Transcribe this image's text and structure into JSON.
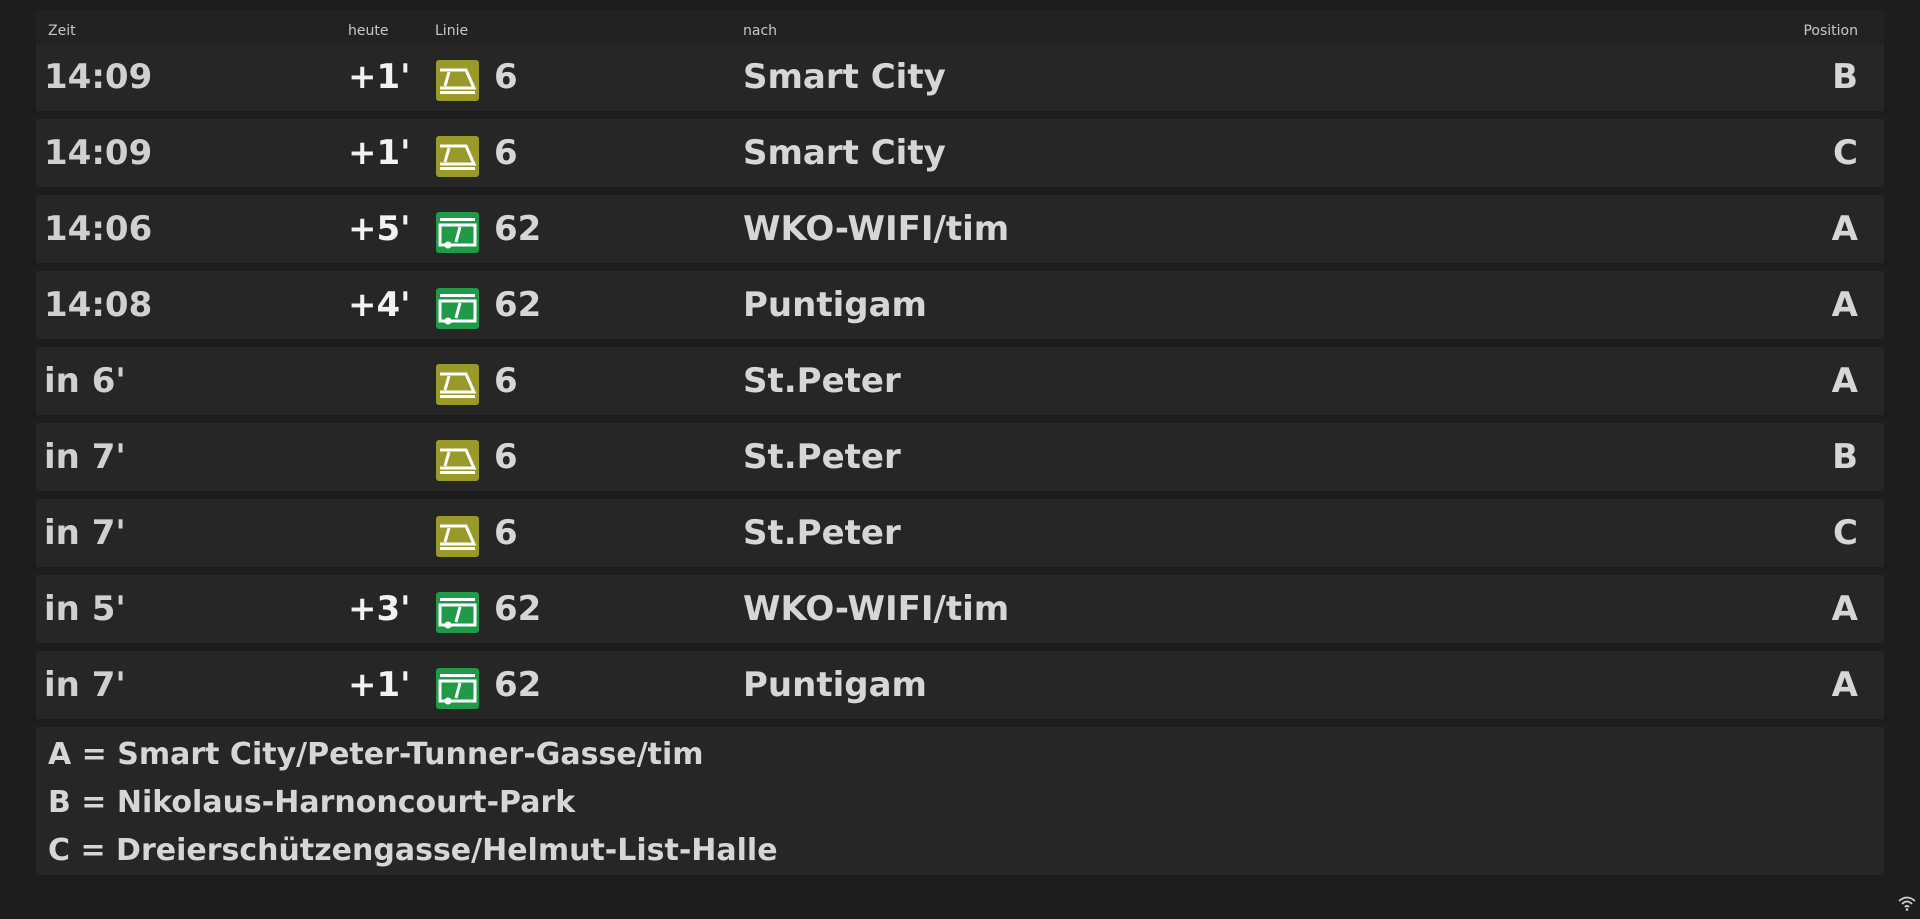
{
  "header": {
    "zeit": "Zeit",
    "heute": "heute",
    "linie": "Linie",
    "nach": "nach",
    "position": "Position"
  },
  "departures": [
    {
      "time": "14:09",
      "delay": "+1'",
      "icon": "tram-icon",
      "line": "6",
      "destination": "Smart City",
      "position": "B"
    },
    {
      "time": "14:09",
      "delay": "+1'",
      "icon": "tram-icon",
      "line": "6",
      "destination": "Smart City",
      "position": "C"
    },
    {
      "time": "14:06",
      "delay": "+5'",
      "icon": "bus-icon",
      "line": "62",
      "destination": "WKO-WIFI/tim",
      "position": "A"
    },
    {
      "time": "14:08",
      "delay": "+4'",
      "icon": "bus-icon",
      "line": "62",
      "destination": "Puntigam",
      "position": "A"
    },
    {
      "time": "in 6'",
      "delay": "",
      "icon": "tram-icon",
      "line": "6",
      "destination": "St.Peter",
      "position": "A"
    },
    {
      "time": "in 7'",
      "delay": "",
      "icon": "tram-icon",
      "line": "6",
      "destination": "St.Peter",
      "position": "B"
    },
    {
      "time": "in 7'",
      "delay": "",
      "icon": "tram-icon",
      "line": "6",
      "destination": "St.Peter",
      "position": "C"
    },
    {
      "time": "in 5'",
      "delay": "+3'",
      "icon": "bus-icon",
      "line": "62",
      "destination": "WKO-WIFI/tim",
      "position": "A"
    },
    {
      "time": "in 7'",
      "delay": "+1'",
      "icon": "bus-icon",
      "line": "62",
      "destination": "Puntigam",
      "position": "A"
    }
  ],
  "legend": [
    "A = Smart City/Peter-Tunner-Gasse/tim",
    "B = Nikolaus-Harnoncourt-Park",
    "C = Dreierschützengasse/Helmut-List-Halle"
  ],
  "status_icon": "wifi-icon",
  "colors": {
    "background": "#1d1d1d",
    "row": "#262626",
    "tram": "#9a9a2a",
    "bus": "#1f9a48"
  }
}
